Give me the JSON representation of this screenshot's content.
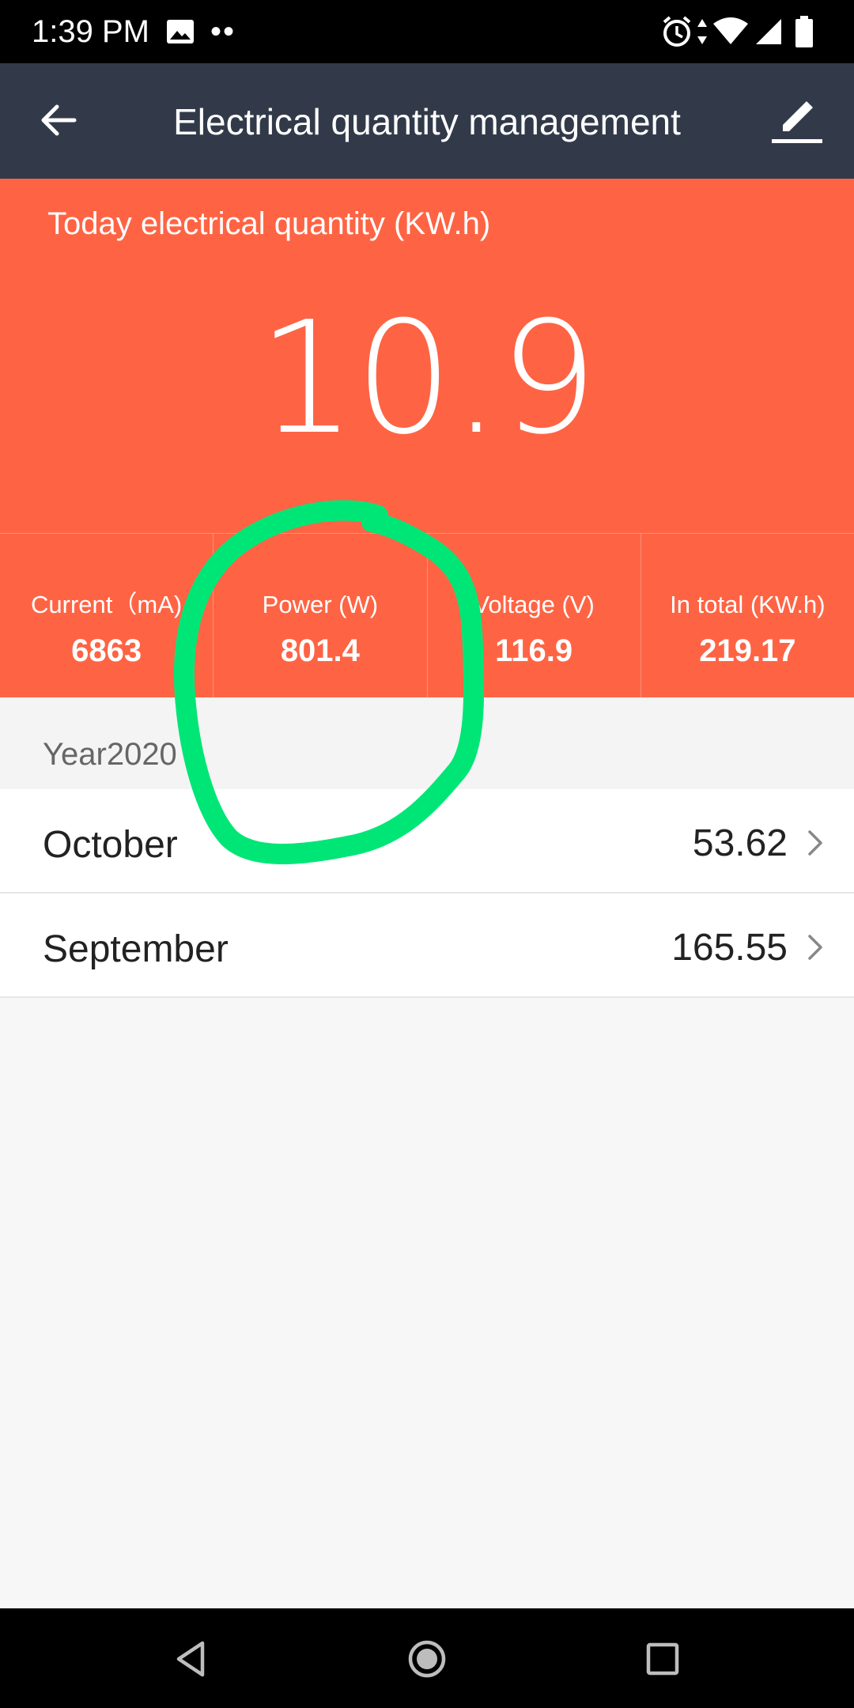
{
  "status_bar": {
    "time": "1:39 PM",
    "dots": "••",
    "icons": [
      "gallery-icon",
      "alarm-icon",
      "data-arrows-icon",
      "wifi-icon",
      "cell-signal-icon",
      "battery-icon"
    ]
  },
  "app_bar": {
    "title": "Electrical quantity management",
    "back_icon": "back-arrow-icon",
    "edit_icon": "edit-pencil-icon",
    "background": "#323a4a"
  },
  "hero": {
    "label": "Today electrical quantity (KW.h)",
    "value": "10.9",
    "background": "#fe6444"
  },
  "stats": [
    {
      "label": "Current（mA)",
      "value": "6863"
    },
    {
      "label": "Power (W)",
      "value": "801.4"
    },
    {
      "label": "Voltage (V)",
      "value": "116.9"
    },
    {
      "label": "In total (KW.h)",
      "value": "219.17"
    }
  ],
  "year_header": {
    "label": "Year2020"
  },
  "months": [
    {
      "name": "October",
      "value": "53.62"
    },
    {
      "name": "September",
      "value": "165.55"
    }
  ],
  "annotation": {
    "color": "#00e676",
    "shape": "hand-drawn circle around Power (W)"
  },
  "nav_bar": {
    "icons": [
      "nav-back-icon",
      "nav-home-icon",
      "nav-recents-icon"
    ]
  }
}
